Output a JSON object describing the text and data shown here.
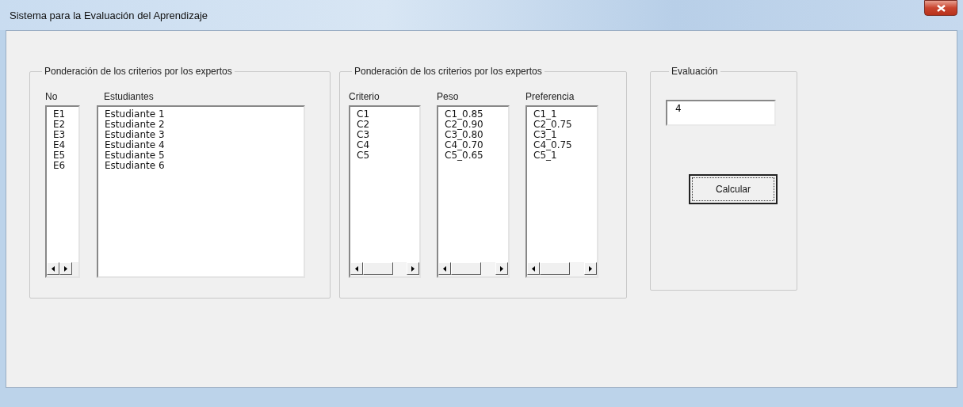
{
  "window": {
    "title": "Sistema para la Evaluación del Aprendizaje"
  },
  "groups": [
    {
      "kind": "lists",
      "title": "Ponderación de los criterios por los expertos",
      "columns": [
        {
          "heading": "No",
          "kind": "compact",
          "items": [
            "E1",
            "E2",
            "E3",
            "E4",
            "E5",
            "E6"
          ]
        },
        {
          "heading": "Estudiantes",
          "kind": "plain",
          "items": [
            "Estudiante 1",
            "Estudiante 2",
            "Estudiante 3",
            "Estudiante 4",
            "Estudiante 5",
            "Estudiante 6"
          ]
        }
      ]
    },
    {
      "kind": "lists",
      "title": "Ponderación de los criterios por los expertos",
      "columns": [
        {
          "heading": "Criterio",
          "kind": "scrolling",
          "items": [
            "C1",
            "C2",
            "C3",
            "C4",
            "C5"
          ]
        },
        {
          "heading": "Peso",
          "kind": "scrolling",
          "items": [
            "C1_0.85",
            "C2_0.90",
            "C3_0.80",
            "C4_0.70",
            "C5_0.65"
          ]
        },
        {
          "heading": "Preferencia",
          "kind": "scrolling",
          "items": [
            "C1_1",
            "C2_0.75",
            "C3_1",
            "C4_0.75",
            "C5_1"
          ]
        }
      ]
    },
    {
      "kind": "evaluation",
      "title": "Evaluación",
      "field": {
        "value": "4"
      },
      "button": {
        "label": "Calcular",
        "focused": true
      }
    }
  ]
}
